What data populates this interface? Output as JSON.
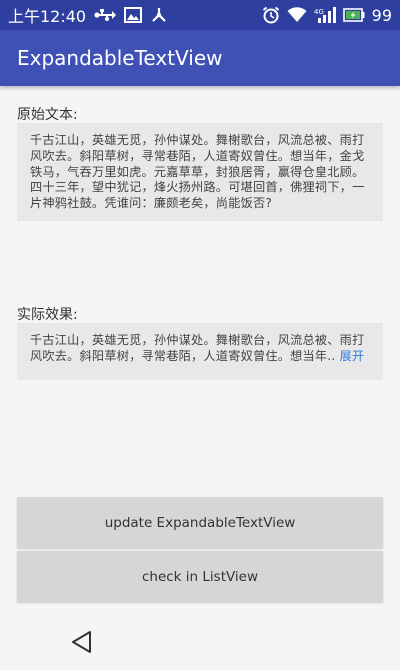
{
  "status_bar": {
    "time": "上午12:40",
    "battery": "99",
    "icons": [
      "usb-icon",
      "image-icon",
      "usb-debug-icon",
      "alarm-icon",
      "wifi-icon",
      "signal-4g-icon",
      "battery-icon"
    ]
  },
  "app_bar": {
    "title": "ExpandableTextView"
  },
  "original": {
    "label": "原始文本:",
    "lines": [
      "千古江山，英雄无觅，孙仲谋处。舞榭歌台，风流总被、雨打",
      "风吹去。斜阳草树，寻常巷陌，人道寄奴曾住。想当年，金戈",
      "铁马，气吞万里如虎。元嘉草草，封狼居胥，赢得仓皇北顾。",
      "四十三年，望中犹记，烽火扬州路。可堪回首，佛狸祠下，一",
      "片神鸦社鼓。凭谁问：廉颇老矣，尚能饭否?"
    ]
  },
  "actual": {
    "label": "实际效果:",
    "line1": "千古江山，英雄无觅，孙仲谋处。舞榭歌台，风流总被、雨打",
    "line2": "风吹去。斜阳草树，寻常巷陌，人道寄奴曾住。想当年..",
    "expand_label": "展开"
  },
  "buttons": {
    "update_label": "update ExpandableTextView",
    "listview_label": "check in ListView"
  },
  "nav": {
    "back_icon": "back-triangle-icon"
  },
  "colors": {
    "status_bar": "#2f3f9f",
    "app_bar": "#3f51b5",
    "link": "#2a7bd8",
    "button": "#d6d6d6"
  }
}
